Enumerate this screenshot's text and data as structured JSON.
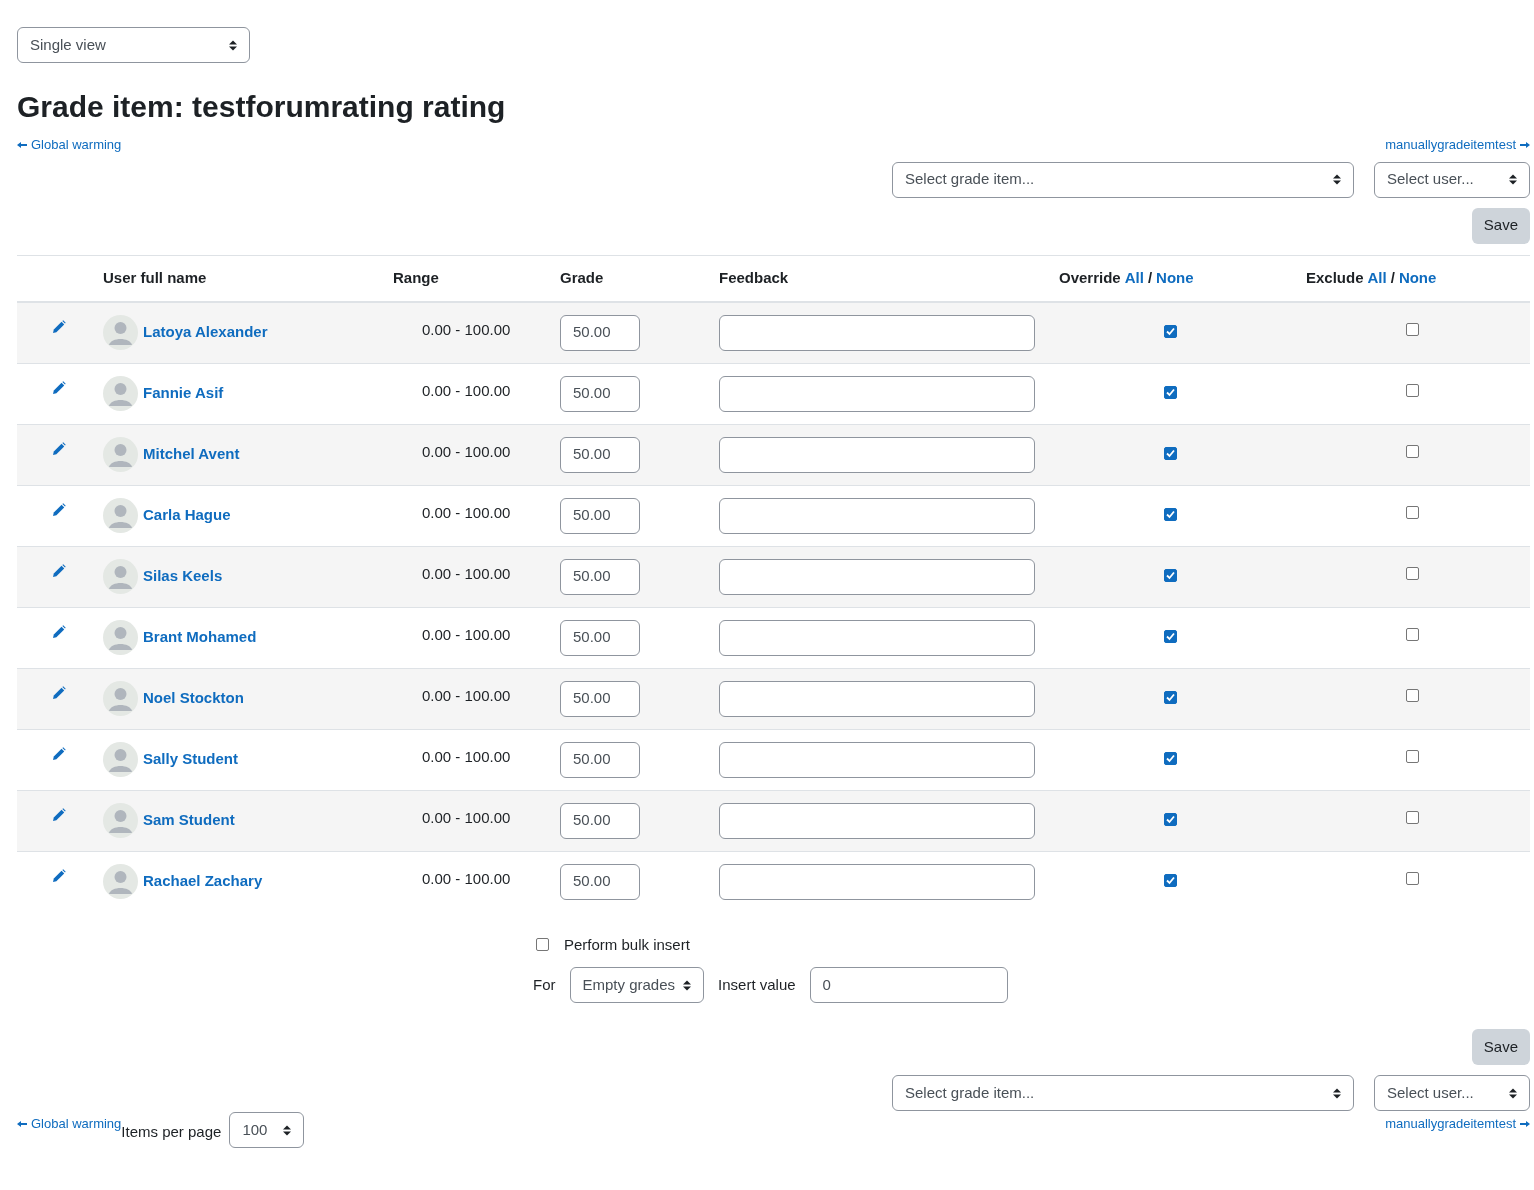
{
  "view_select": {
    "value": "Single view"
  },
  "title": "Grade item: testforumrating rating",
  "nav_top": {
    "prev": "Global warming",
    "next": "manuallygradeitemtest"
  },
  "top_controls": {
    "grade_item_select": "Select grade item...",
    "user_select": "Select user...",
    "save": "Save"
  },
  "table": {
    "columns": [
      {
        "label": "User full name"
      },
      {
        "label": "Range"
      },
      {
        "label": "Grade"
      },
      {
        "label": "Feedback"
      },
      {
        "label": "Override",
        "all": "All",
        "separator": "/",
        "none": "None"
      },
      {
        "label": "Exclude",
        "all": "All",
        "separator": "/",
        "none": "None"
      }
    ],
    "rows": [
      {
        "name": "Latoya Alexander",
        "range": "0.00 - 100.00",
        "grade": "50.00",
        "override": true,
        "exclude": false
      },
      {
        "name": "Fannie Asif",
        "range": "0.00 - 100.00",
        "grade": "50.00",
        "override": true,
        "exclude": false
      },
      {
        "name": "Mitchel Avent",
        "range": "0.00 - 100.00",
        "grade": "50.00",
        "override": true,
        "exclude": false
      },
      {
        "name": "Carla Hague",
        "range": "0.00 - 100.00",
        "grade": "50.00",
        "override": true,
        "exclude": false
      },
      {
        "name": "Silas Keels",
        "range": "0.00 - 100.00",
        "grade": "50.00",
        "override": true,
        "exclude": false
      },
      {
        "name": "Brant Mohamed",
        "range": "0.00 - 100.00",
        "grade": "50.00",
        "override": true,
        "exclude": false
      },
      {
        "name": "Noel Stockton",
        "range": "0.00 - 100.00",
        "grade": "50.00",
        "override": true,
        "exclude": false
      },
      {
        "name": "Sally Student",
        "range": "0.00 - 100.00",
        "grade": "50.00",
        "override": true,
        "exclude": false
      },
      {
        "name": "Sam Student",
        "range": "0.00 - 100.00",
        "grade": "50.00",
        "override": true,
        "exclude": false
      },
      {
        "name": "Rachael Zachary",
        "range": "0.00 - 100.00",
        "grade": "50.00",
        "override": true,
        "exclude": false
      }
    ]
  },
  "bulk": {
    "label": "Perform bulk insert",
    "checked": false,
    "for_label": "For",
    "for_value": "Empty grades",
    "insert_label": "Insert value",
    "insert_value": "0"
  },
  "bottom_controls": {
    "save": "Save",
    "grade_item_select": "Select grade item...",
    "user_select": "Select user..."
  },
  "nav_bottom": {
    "prev": "Global warming",
    "next": "manuallygradeitemtest"
  },
  "items_per_page": {
    "label": "Items per page",
    "value": "100"
  }
}
